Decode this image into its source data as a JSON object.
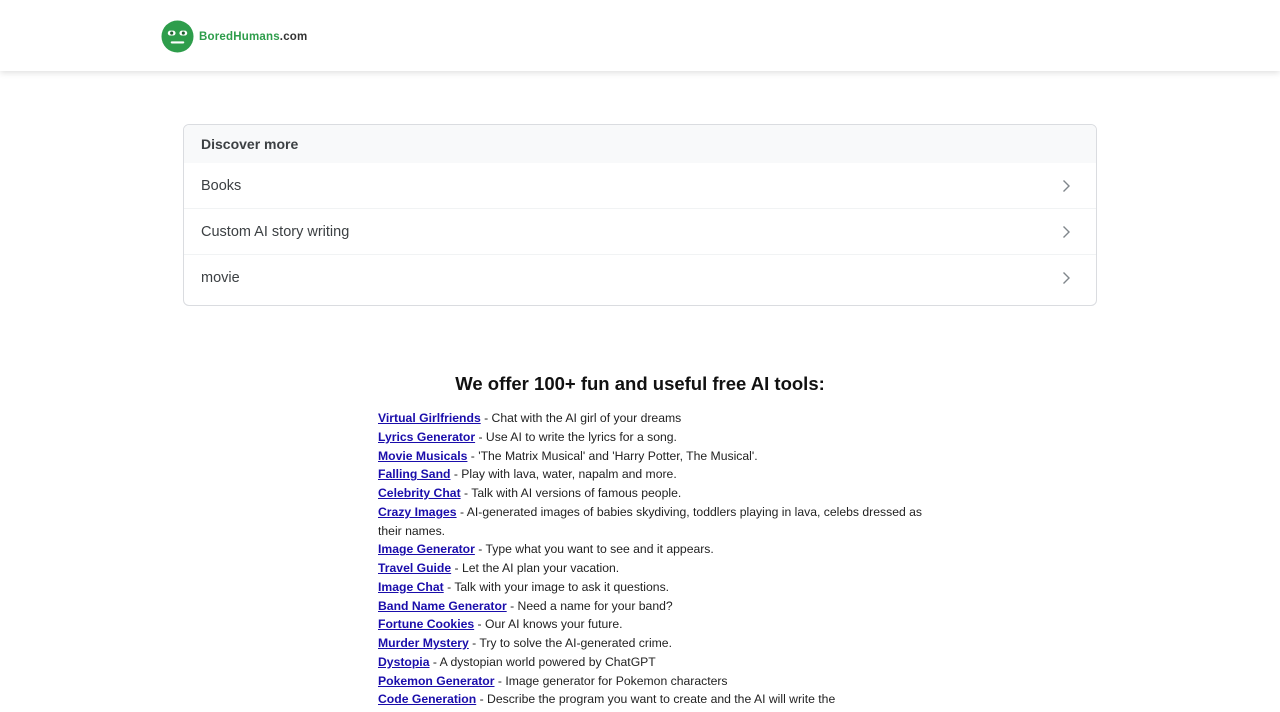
{
  "header": {
    "logo": {
      "brand": "BoredHumans",
      "suffix": ".com",
      "icon": "smiley-face-icon",
      "color": "#2e9d4b"
    }
  },
  "discover": {
    "title": "Discover more",
    "items": [
      {
        "label": "Books"
      },
      {
        "label": "Custom AI story writing"
      },
      {
        "label": "movie"
      }
    ]
  },
  "tools": {
    "title": "We offer 100+ fun and useful free AI tools:",
    "link_color": "#1a0dab",
    "items": [
      {
        "name": "Virtual Girlfriends",
        "desc": " - Chat with the AI girl of your dreams"
      },
      {
        "name": "Lyrics Generator",
        "desc": " - Use AI to write the lyrics for a song."
      },
      {
        "name": "Movie Musicals",
        "desc": " - 'The Matrix Musical' and 'Harry Potter, The Musical'."
      },
      {
        "name": "Falling Sand",
        "desc": " - Play with lava, water, napalm and more."
      },
      {
        "name": "Celebrity Chat",
        "desc": " - Talk with AI versions of famous people."
      },
      {
        "name": "Crazy Images",
        "desc": " - AI-generated images of babies skydiving, toddlers playing in lava, celebs dressed as their names."
      },
      {
        "name": "Image Generator",
        "desc": " - Type what you want to see and it appears."
      },
      {
        "name": "Travel Guide",
        "desc": " - Let the AI plan your vacation."
      },
      {
        "name": "Image Chat",
        "desc": " - Talk with your image to ask it questions."
      },
      {
        "name": "Band Name Generator",
        "desc": " - Need a name for your band?"
      },
      {
        "name": "Fortune Cookies",
        "desc": " - Our AI knows your future."
      },
      {
        "name": "Murder Mystery",
        "desc": " - Try to solve the AI-generated crime."
      },
      {
        "name": "Dystopia",
        "desc": " - A dystopian world powered by ChatGPT"
      },
      {
        "name": "Pokemon Generator",
        "desc": " - Image generator for Pokemon characters"
      },
      {
        "name": "Code Generation",
        "desc": " - Describe the program you want to create and the AI will write the"
      }
    ]
  }
}
